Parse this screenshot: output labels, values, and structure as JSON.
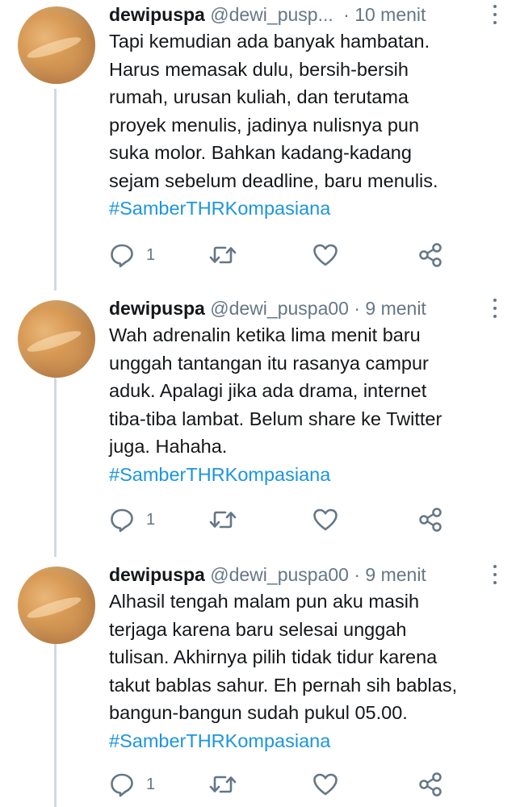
{
  "tweets": [
    {
      "name": "dewipuspa",
      "handle": "@dewi_pusp...",
      "time": "· 10 menit",
      "lines": [
        "Tapi kemudian ada banyak hambatan.",
        "Harus memasak dulu, bersih-bersih",
        "rumah, urusan kuliah, dan terutama",
        "proyek menulis, jadinya nulisnya pun",
        "suka molor. Bahkan kadang-kadang",
        "sejam sebelum deadline, baru menulis."
      ],
      "hashtag": "#SamberTHRKompasiana",
      "reply_count": "1"
    },
    {
      "name": "dewipuspa",
      "handle": "@dewi_puspa00",
      "time": "· 9 menit",
      "lines": [
        "Wah adrenalin ketika lima menit baru",
        "unggah tantangan itu rasanya campur",
        "aduk. Apalagi jika ada drama, internet",
        "tiba-tiba lambat. Belum share ke Twitter",
        "juga. Hahaha."
      ],
      "hashtag": "#SamberTHRKompasiana",
      "reply_count": "1"
    },
    {
      "name": "dewipuspa",
      "handle": "@dewi_puspa00",
      "time": "· 9 menit",
      "lines": [
        "Alhasil tengah malam pun aku masih",
        "terjaga karena baru selesai unggah",
        "tulisan. Akhirnya pilih tidak tidur karena",
        "takut bablas sahur. Eh pernah sih bablas,",
        "bangun-bangun sudah pukul 05.00."
      ],
      "hashtag": "#SamberTHRKompasiana",
      "reply_count": "1"
    }
  ],
  "icons": {
    "reply": "reply-icon",
    "retweet": "retweet-icon",
    "like": "heart-icon",
    "share": "share-icon",
    "more": "more-icon"
  },
  "colors": {
    "hashtag": "#1b95e0",
    "secondary": "#657786",
    "thread_line": "#cfd9de"
  }
}
